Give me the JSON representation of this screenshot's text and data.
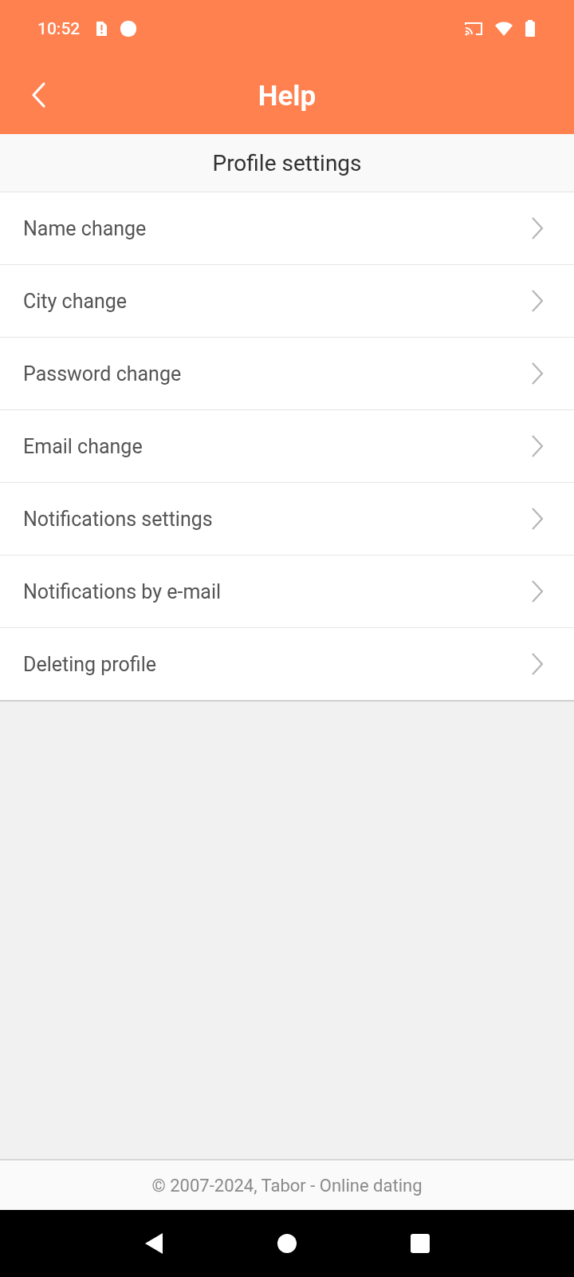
{
  "status_bar": {
    "time": "10:52"
  },
  "header": {
    "title": "Help"
  },
  "section": {
    "title": "Profile settings"
  },
  "items": [
    {
      "label": "Name change"
    },
    {
      "label": "City change"
    },
    {
      "label": "Password change"
    },
    {
      "label": "Email change"
    },
    {
      "label": "Notifications settings"
    },
    {
      "label": "Notifications by e-mail"
    },
    {
      "label": "Deleting profile"
    }
  ],
  "footer": {
    "text": "© 2007-2024, Tabor - Online dating"
  }
}
